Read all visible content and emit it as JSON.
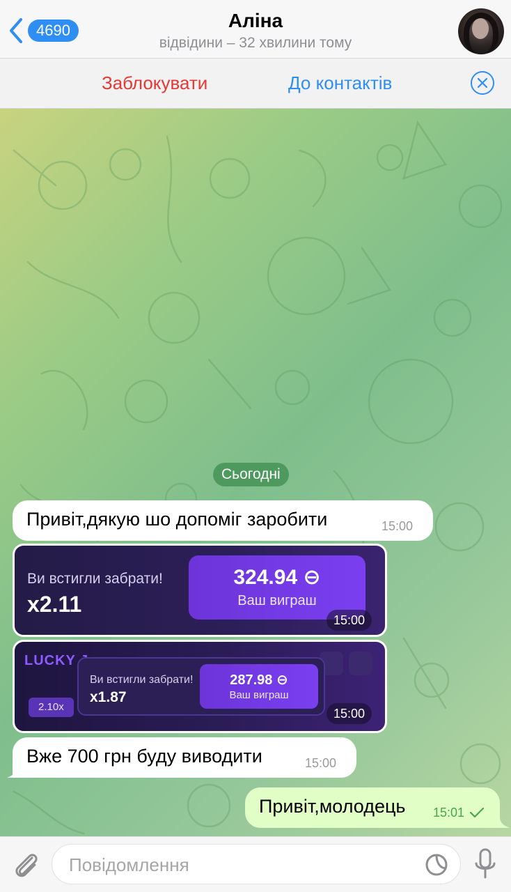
{
  "header": {
    "unread_count": "4690",
    "name": "Аліна",
    "status": "відвідини – 32 хвилини тому"
  },
  "actions": {
    "block": "Заблокувати",
    "add_contact": "До контактів"
  },
  "chat": {
    "date_separator": "Сьогодні",
    "messages": [
      {
        "text": "Привіт,дякую шо допоміг заробити",
        "time": "15:00"
      },
      {
        "text": "Вже 700 грн буду виводити",
        "time": "15:00"
      },
      {
        "text": "Привіт,молодець",
        "time": "15:01"
      }
    ],
    "images": [
      {
        "caught": "Ви встигли забрати!",
        "multiplier": "x2.11",
        "amount": "324.94 ⊖",
        "label": "Ваш виграш",
        "time": "15:00"
      },
      {
        "logo": "LUCKY J",
        "chip": "2.10x",
        "caught": "Ви встигли забрати!",
        "multiplier": "x1.87",
        "amount": "287.98 ⊖",
        "label": "Ваш виграш",
        "time": "15:00"
      }
    ]
  },
  "input": {
    "placeholder": "Повідомлення"
  },
  "colors": {
    "accent": "#2f8ef4",
    "danger": "#e53935",
    "outgoing_bubble": "#e1fec6",
    "date_pill": "#4e9a5e"
  },
  "icons": [
    "back-chevron-icon",
    "close-icon",
    "checkmark-icon",
    "paperclip-icon",
    "sticker-icon",
    "microphone-icon"
  ]
}
